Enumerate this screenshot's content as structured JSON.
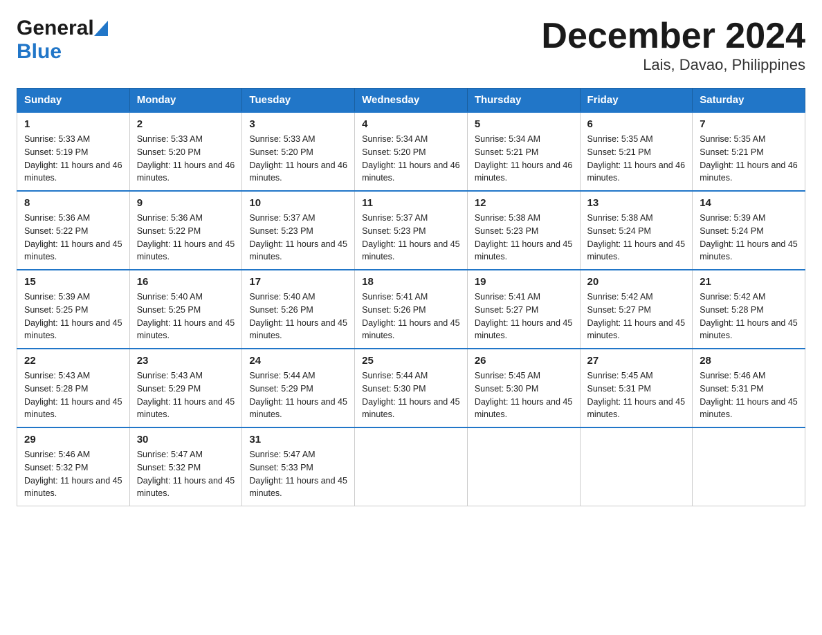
{
  "header": {
    "logo_general": "General",
    "logo_blue": "Blue",
    "title": "December 2024",
    "subtitle": "Lais, Davao, Philippines"
  },
  "days_of_week": [
    "Sunday",
    "Monday",
    "Tuesday",
    "Wednesday",
    "Thursday",
    "Friday",
    "Saturday"
  ],
  "weeks": [
    [
      {
        "day": "1",
        "sunrise": "5:33 AM",
        "sunset": "5:19 PM",
        "daylight": "11 hours and 46 minutes."
      },
      {
        "day": "2",
        "sunrise": "5:33 AM",
        "sunset": "5:20 PM",
        "daylight": "11 hours and 46 minutes."
      },
      {
        "day": "3",
        "sunrise": "5:33 AM",
        "sunset": "5:20 PM",
        "daylight": "11 hours and 46 minutes."
      },
      {
        "day": "4",
        "sunrise": "5:34 AM",
        "sunset": "5:20 PM",
        "daylight": "11 hours and 46 minutes."
      },
      {
        "day": "5",
        "sunrise": "5:34 AM",
        "sunset": "5:21 PM",
        "daylight": "11 hours and 46 minutes."
      },
      {
        "day": "6",
        "sunrise": "5:35 AM",
        "sunset": "5:21 PM",
        "daylight": "11 hours and 46 minutes."
      },
      {
        "day": "7",
        "sunrise": "5:35 AM",
        "sunset": "5:21 PM",
        "daylight": "11 hours and 46 minutes."
      }
    ],
    [
      {
        "day": "8",
        "sunrise": "5:36 AM",
        "sunset": "5:22 PM",
        "daylight": "11 hours and 45 minutes."
      },
      {
        "day": "9",
        "sunrise": "5:36 AM",
        "sunset": "5:22 PM",
        "daylight": "11 hours and 45 minutes."
      },
      {
        "day": "10",
        "sunrise": "5:37 AM",
        "sunset": "5:23 PM",
        "daylight": "11 hours and 45 minutes."
      },
      {
        "day": "11",
        "sunrise": "5:37 AM",
        "sunset": "5:23 PM",
        "daylight": "11 hours and 45 minutes."
      },
      {
        "day": "12",
        "sunrise": "5:38 AM",
        "sunset": "5:23 PM",
        "daylight": "11 hours and 45 minutes."
      },
      {
        "day": "13",
        "sunrise": "5:38 AM",
        "sunset": "5:24 PM",
        "daylight": "11 hours and 45 minutes."
      },
      {
        "day": "14",
        "sunrise": "5:39 AM",
        "sunset": "5:24 PM",
        "daylight": "11 hours and 45 minutes."
      }
    ],
    [
      {
        "day": "15",
        "sunrise": "5:39 AM",
        "sunset": "5:25 PM",
        "daylight": "11 hours and 45 minutes."
      },
      {
        "day": "16",
        "sunrise": "5:40 AM",
        "sunset": "5:25 PM",
        "daylight": "11 hours and 45 minutes."
      },
      {
        "day": "17",
        "sunrise": "5:40 AM",
        "sunset": "5:26 PM",
        "daylight": "11 hours and 45 minutes."
      },
      {
        "day": "18",
        "sunrise": "5:41 AM",
        "sunset": "5:26 PM",
        "daylight": "11 hours and 45 minutes."
      },
      {
        "day": "19",
        "sunrise": "5:41 AM",
        "sunset": "5:27 PM",
        "daylight": "11 hours and 45 minutes."
      },
      {
        "day": "20",
        "sunrise": "5:42 AM",
        "sunset": "5:27 PM",
        "daylight": "11 hours and 45 minutes."
      },
      {
        "day": "21",
        "sunrise": "5:42 AM",
        "sunset": "5:28 PM",
        "daylight": "11 hours and 45 minutes."
      }
    ],
    [
      {
        "day": "22",
        "sunrise": "5:43 AM",
        "sunset": "5:28 PM",
        "daylight": "11 hours and 45 minutes."
      },
      {
        "day": "23",
        "sunrise": "5:43 AM",
        "sunset": "5:29 PM",
        "daylight": "11 hours and 45 minutes."
      },
      {
        "day": "24",
        "sunrise": "5:44 AM",
        "sunset": "5:29 PM",
        "daylight": "11 hours and 45 minutes."
      },
      {
        "day": "25",
        "sunrise": "5:44 AM",
        "sunset": "5:30 PM",
        "daylight": "11 hours and 45 minutes."
      },
      {
        "day": "26",
        "sunrise": "5:45 AM",
        "sunset": "5:30 PM",
        "daylight": "11 hours and 45 minutes."
      },
      {
        "day": "27",
        "sunrise": "5:45 AM",
        "sunset": "5:31 PM",
        "daylight": "11 hours and 45 minutes."
      },
      {
        "day": "28",
        "sunrise": "5:46 AM",
        "sunset": "5:31 PM",
        "daylight": "11 hours and 45 minutes."
      }
    ],
    [
      {
        "day": "29",
        "sunrise": "5:46 AM",
        "sunset": "5:32 PM",
        "daylight": "11 hours and 45 minutes."
      },
      {
        "day": "30",
        "sunrise": "5:47 AM",
        "sunset": "5:32 PM",
        "daylight": "11 hours and 45 minutes."
      },
      {
        "day": "31",
        "sunrise": "5:47 AM",
        "sunset": "5:33 PM",
        "daylight": "11 hours and 45 minutes."
      },
      null,
      null,
      null,
      null
    ]
  ]
}
